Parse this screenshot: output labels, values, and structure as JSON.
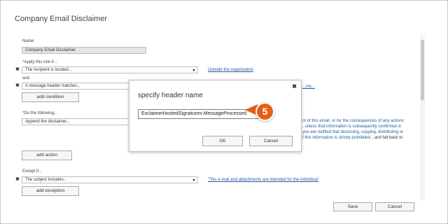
{
  "window": {
    "title": "Company Email Disclaimer"
  },
  "form": {
    "name_label": "Name:",
    "name_value": "Company Email Disclaimer",
    "apply_label": "*Apply this rule if...",
    "condition1": {
      "value": "The recipient is located...",
      "link": "Outside the organization"
    },
    "and_label": "and",
    "condition2": {
      "value": "A message header matches...",
      "link_fragment": "...ms..."
    },
    "add_condition": "add condition",
    "do_label": "*Do the following...",
    "action": {
      "value": "Append the disclaimer..."
    },
    "disclaimer_lines": [
      "nt of this email, or for the consequences of any actions",
      ", unless that information is subsequently confirmed in",
      "you are notified that disclosing, copying, distributing or",
      "f this information is strictly prohibited.'"
    ],
    "disclaimer_tail": ", and fall back to",
    "add_action": "add action",
    "except_label": "Except if...",
    "exception": {
      "value": "The subject includes...",
      "link": "'This e-mail and attachments are intended for the individual'"
    },
    "add_exception": "add exception"
  },
  "footer": {
    "save": "Save",
    "cancel": "Cancel"
  },
  "dialog": {
    "title": "specify header name",
    "input_value": "ExclaimerHostedSignatures-MessageProcessed",
    "ok": "OK",
    "cancel": "Cancel"
  },
  "callout": {
    "step": "5",
    "color": "#e55f17"
  },
  "colors": {
    "link": "#1e5a9c",
    "accent": "#e55f17"
  },
  "icons": {
    "remove": "close-icon",
    "dropdown": "chevron-down-icon"
  }
}
